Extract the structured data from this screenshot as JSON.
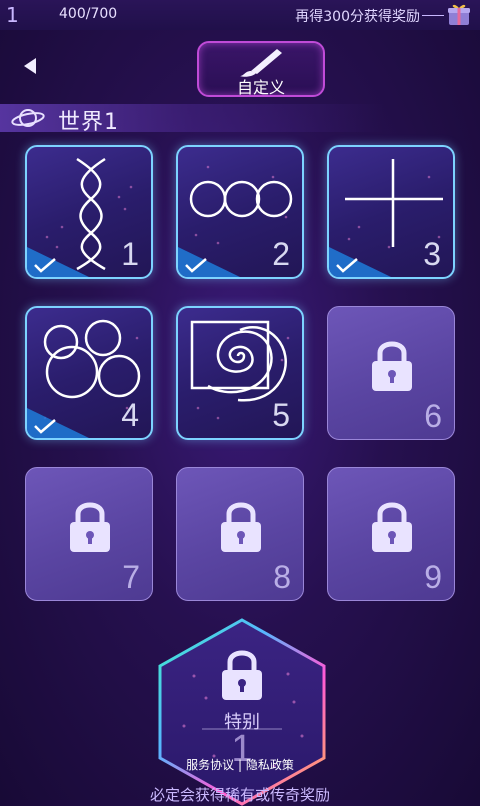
{
  "topbar": {
    "level": "1",
    "progress": "400/700",
    "reward_text": "再得300分获得奖励"
  },
  "header": {
    "custom_label": "自定义"
  },
  "world": {
    "title": "世界1"
  },
  "levels": [
    {
      "number": "1",
      "shape": "double-helix",
      "completed": true
    },
    {
      "number": "2",
      "shape": "three-rings",
      "completed": true
    },
    {
      "number": "3",
      "shape": "cross",
      "completed": true
    },
    {
      "number": "4",
      "shape": "circle-cluster",
      "completed": true
    },
    {
      "number": "5",
      "shape": "spiral",
      "completed": false
    },
    {
      "number": "6",
      "shape": "lock-icon",
      "completed": false
    },
    {
      "number": "7",
      "shape": "lock-icon",
      "completed": false
    },
    {
      "number": "8",
      "shape": "lock-icon",
      "completed": false
    },
    {
      "number": "9",
      "shape": "lock-icon",
      "completed": false
    }
  ],
  "special": {
    "label": "特别",
    "number": "1"
  },
  "footer": {
    "terms": "服务协议",
    "privacy": "隐私政策",
    "notice": "必定会获得稀有或传奇奖励"
  },
  "colors": {
    "accent_blue": "#7dd3ff",
    "accent_magenta": "#c04bd8",
    "locked_card": "#5a45a2"
  }
}
